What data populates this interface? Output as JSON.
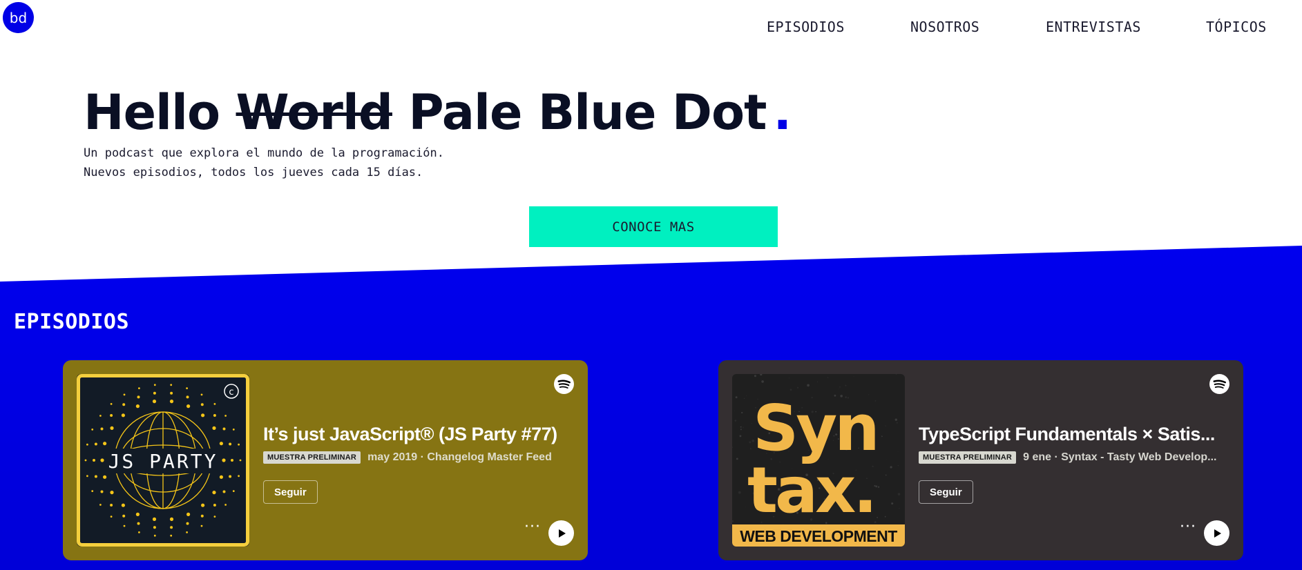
{
  "header": {
    "logo_text": "bd",
    "nav": [
      {
        "label": "EPISODIOS"
      },
      {
        "label": "NOSOTROS"
      },
      {
        "label": "ENTREVISTAS"
      },
      {
        "label": "TÓPICOS"
      }
    ]
  },
  "hero": {
    "title_start": "Hello",
    "title_struck": "World",
    "title_end": "Pale Blue Dot",
    "title_dot": ".",
    "subtitle_line1": "Un podcast que explora el mundo de la programación.",
    "subtitle_line2": "Nuevos episodios, todos los jueves cada 15 días.",
    "cta_label": "CONOCE MAS"
  },
  "episodes": {
    "section_title": "EPISODIOS",
    "cards": [
      {
        "title": "It’s just JavaScript® (JS Party #77)",
        "badge": "MUESTRA PRELIMINAR",
        "meta": "may 2019 · Changelog Master Feed",
        "follow_label": "Seguir",
        "more_label": "···",
        "art_text": "JS PARTY",
        "art_corner": "c",
        "bg_color": "#867413",
        "art_bg": "#121b26",
        "art_border": "#f5cf3d",
        "art_accent": "#f5c518"
      },
      {
        "title": "TypeScript Fundamentals × Satis...",
        "badge": "MUESTRA PRELIMINAR",
        "meta": "9 ene · Syntax - Tasty Web Develop...",
        "follow_label": "Seguir",
        "more_label": "···",
        "art_line1": "Syn",
        "art_line2": "tax.",
        "art_footer": "WEB DEVELOPMENT",
        "bg_color": "#342f31",
        "art_bg": "#1f1f1f",
        "art_accent": "#f2b84a"
      }
    ]
  },
  "colors": {
    "brand_blue": "#0000e6",
    "cta_teal": "#00f0c0",
    "text_dark": "#0a0f24"
  },
  "icons": [
    "spotify-icon",
    "play-icon",
    "more-icon"
  ]
}
